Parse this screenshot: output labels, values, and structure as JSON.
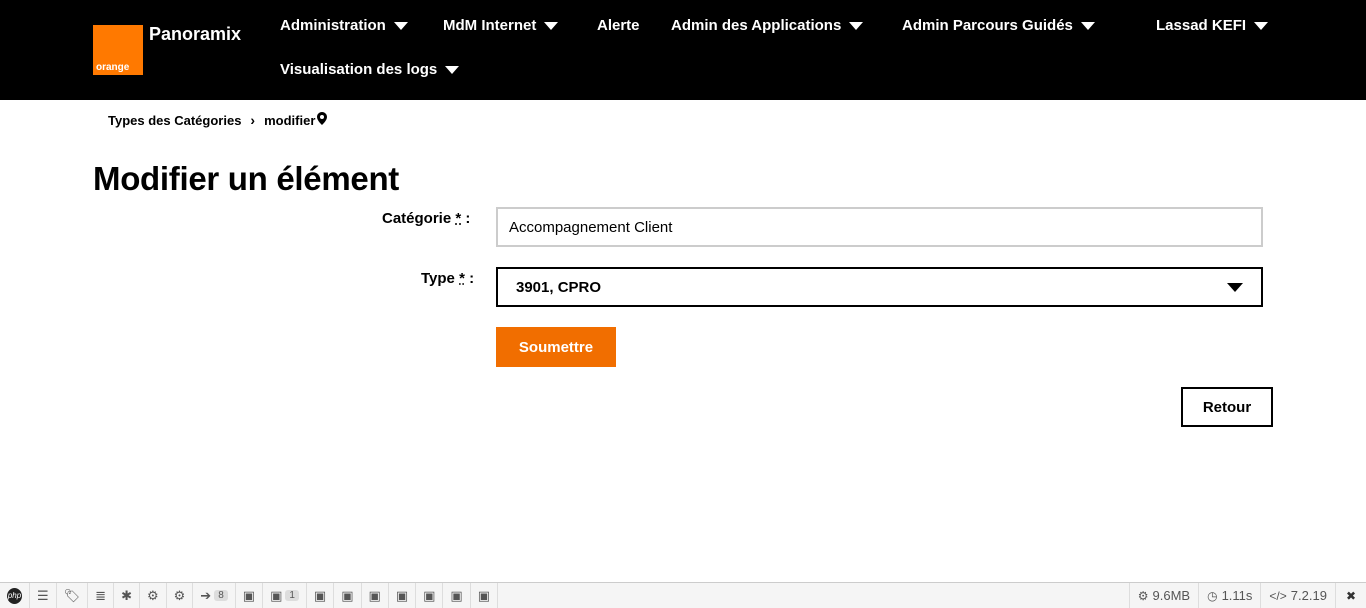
{
  "header": {
    "logo_text": "orange",
    "brand": "Panoramix",
    "nav": [
      {
        "label": "Administration"
      },
      {
        "label": "MdM Internet"
      },
      {
        "label": "Alerte"
      },
      {
        "label": "Admin des Applications"
      },
      {
        "label": "Admin Parcours Guidés"
      },
      {
        "label": "Visualisation des logs"
      }
    ],
    "user": "Lassad KEFI"
  },
  "breadcrumb": {
    "parent": "Types des Catégories",
    "separator": "›",
    "current": "modifier"
  },
  "page_title": "Modifier un élément",
  "form": {
    "categorie_label": "Catégorie",
    "categorie_value": "Accompagnement Client",
    "type_label": "Type",
    "type_value": "3901, CPRO",
    "required_mark": "*",
    "colon": " :",
    "submit_label": "Soumettre",
    "back_label": "Retour"
  },
  "debugbar": {
    "php_label": "php",
    "requests_count": "8",
    "events_count": "1",
    "memory": "9.6MB",
    "time": "1.11s",
    "version": "7.2.19"
  },
  "colors": {
    "brand_orange": "#ff7900",
    "button_orange": "#f16e00",
    "header_bg": "#000000"
  }
}
